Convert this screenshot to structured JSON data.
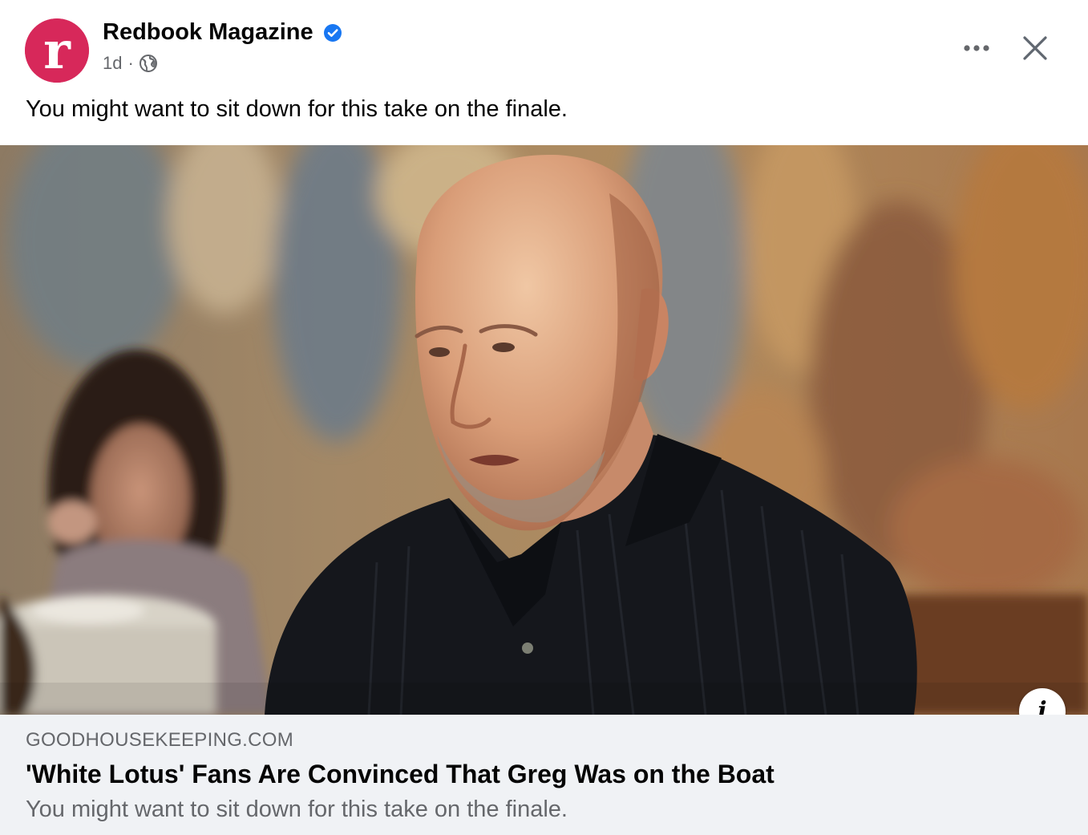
{
  "post": {
    "page_name": "Redbook Magazine",
    "avatar_letter": "r",
    "verified_icon": "verified-badge-icon",
    "time": "1d",
    "separator": "·",
    "audience_icon": "globe-icon",
    "caption": "You might want to sit down for this take on the finale.",
    "actions": {
      "more_icon": "ellipsis-icon",
      "close_icon": "close-icon"
    }
  },
  "link_preview": {
    "domain": "GOODHOUSEKEEPING.COM",
    "title": "'White Lotus' Fans Are Convinced That Greg Was on the Boat",
    "description": "You might want to sit down for this take on the finale.",
    "info_label": "i"
  },
  "colors": {
    "brand": "#d7285a",
    "verified": "#1877f2",
    "text_primary": "#050505",
    "text_secondary": "#65676b",
    "link_background": "#f0f2f5"
  }
}
